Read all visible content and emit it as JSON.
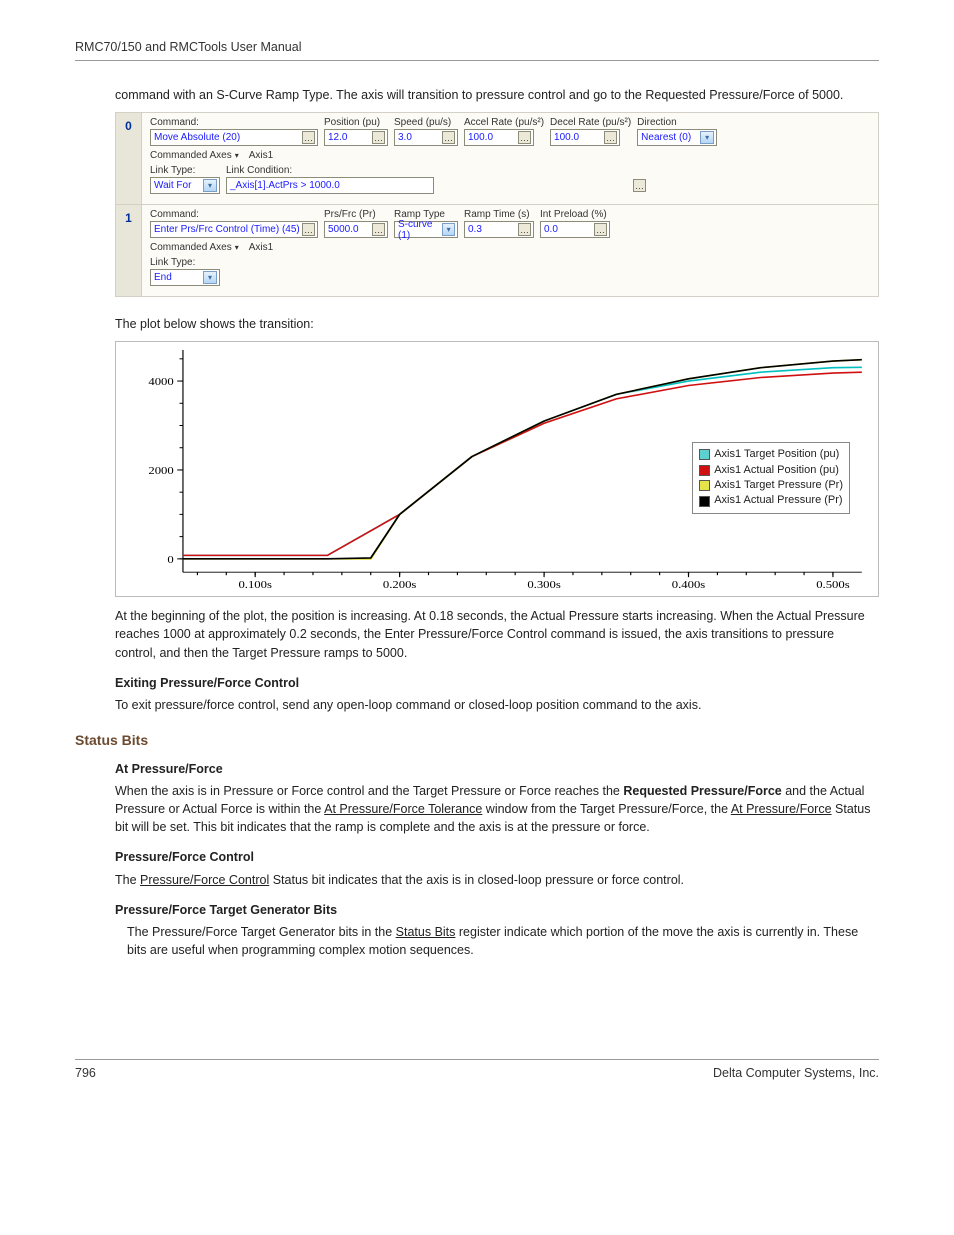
{
  "header": {
    "title": "RMC70/150 and RMCTools User Manual"
  },
  "footer": {
    "page": "796",
    "company": "Delta Computer Systems, Inc."
  },
  "intro": "command with an S-Curve Ramp Type. The axis will transition to pressure control and go to the Requested Pressure/Force of 5000.",
  "steps": [
    {
      "num": "0",
      "fields": [
        {
          "label": "Command:",
          "value": "Move Absolute (20)",
          "w": "wide",
          "edit": "ell"
        },
        {
          "label": "Position (pu)",
          "value": "12.0",
          "w": "w58",
          "edit": "ell"
        },
        {
          "label": "Speed (pu/s)",
          "value": "3.0",
          "w": "w58",
          "edit": "ell"
        },
        {
          "label": "Accel Rate (pu/s²)",
          "value": "100.0",
          "w": "w54",
          "edit": "ell"
        },
        {
          "label": "Decel Rate (pu/s²)",
          "value": "100.0",
          "w": "w54",
          "edit": "ell"
        },
        {
          "label": "Direction",
          "value": "Nearest (0)",
          "w": "dir",
          "edit": "dd"
        }
      ],
      "axes_label": "Commanded Axes",
      "axes_value": "Axis1",
      "link": {
        "type_label": "Link Type:",
        "type_value": "Wait For",
        "cond_label": "Link Condition:",
        "cond_value": "_Axis[1].ActPrs > 1000.0"
      }
    },
    {
      "num": "1",
      "fields": [
        {
          "label": "Command:",
          "value": "Enter Prs/Frc Control (Time) (45)",
          "w": "wide",
          "edit": "ell"
        },
        {
          "label": "Prs/Frc (Pr)",
          "value": "5000.0",
          "w": "w58",
          "edit": "ell"
        },
        {
          "label": "Ramp Type",
          "value": "S-curve (1)",
          "w": "w58",
          "edit": "dd"
        },
        {
          "label": "Ramp Time (s)",
          "value": "0.3",
          "w": "w54",
          "edit": "ell"
        },
        {
          "label": "Int Preload (%)",
          "value": "0.0",
          "w": "w54",
          "edit": "ell"
        }
      ],
      "axes_label": "Commanded Axes",
      "axes_value": "Axis1",
      "link": {
        "type_label": "Link Type:",
        "type_value": "End"
      }
    }
  ],
  "plot_intro": "The plot below shows the transition:",
  "chart_data": {
    "type": "line",
    "xlabel_ticks": [
      "0.100s",
      "0.200s",
      "0.300s",
      "0.400s",
      "0.500s"
    ],
    "y_ticks": [
      0,
      2000,
      4000
    ],
    "xlim": [
      0.05,
      0.52
    ],
    "ylim": [
      -300,
      4700
    ],
    "series": [
      {
        "name": "Axis1 Target Position (pu)",
        "color": "#00bfbf",
        "swatch": "#5dd0d0",
        "x": [
          0.05,
          0.1,
          0.15,
          0.2,
          0.25,
          0.3,
          0.35,
          0.4,
          0.45,
          0.5,
          0.52
        ],
        "values": [
          78,
          78,
          78,
          1000,
          2300,
          3100,
          3700,
          4000,
          4200,
          4300,
          4310
        ]
      },
      {
        "name": "Axis1 Actual Position (pu)",
        "color": "#d01010",
        "swatch": "#d01010",
        "x": [
          0.05,
          0.1,
          0.15,
          0.2,
          0.25,
          0.3,
          0.35,
          0.4,
          0.45,
          0.5,
          0.52
        ],
        "values": [
          78,
          78,
          78,
          1000,
          2300,
          3050,
          3600,
          3900,
          4080,
          4180,
          4200
        ]
      },
      {
        "name": "Axis1 Target Pressure (Pr)",
        "color": "#d0d000",
        "swatch": "#e4e44a",
        "x": [
          0.05,
          0.1,
          0.15,
          0.18,
          0.2,
          0.25,
          0.3,
          0.35,
          0.4,
          0.45,
          0.5,
          0.52
        ],
        "values": [
          0,
          0,
          0,
          0,
          1000,
          2300,
          3100,
          3700,
          4050,
          4300,
          4450,
          4480
        ]
      },
      {
        "name": "Axis1 Actual Pressure (Pr)",
        "color": "#000000",
        "swatch": "#000000",
        "x": [
          0.05,
          0.1,
          0.15,
          0.18,
          0.2,
          0.25,
          0.3,
          0.35,
          0.4,
          0.45,
          0.5,
          0.52
        ],
        "values": [
          0,
          0,
          0,
          20,
          1000,
          2300,
          3100,
          3700,
          4050,
          4300,
          4450,
          4480
        ]
      }
    ]
  },
  "plot_desc": "At the beginning of the plot, the position is increasing. At 0.18 seconds, the Actual Pressure starts increasing. When the Actual Pressure reaches 1000 at approximately 0.2 seconds, the Enter Pressure/Force Control command is issued, the axis transitions to pressure control, and then the Target Pressure ramps to 5000.",
  "exit_h": "Exiting Pressure/Force Control",
  "exit_p": "To exit pressure/force control, send any open-loop command or closed-loop position command to the axis.",
  "status_h": "Status Bits",
  "at_h": "At Pressure/Force",
  "at_p1a": "When the axis is in Pressure or Force control and the Target Pressure or Force reaches the ",
  "at_p1b": "Requested Pressure/Force",
  "at_p1c": " and the Actual Pressure or Actual Force is within the ",
  "at_p1d": "At Pressure/Force Tolerance",
  "at_p1e": " window from the Target Pressure/Force, the ",
  "at_p1f": "At Pressure/Force",
  "at_p1g": " Status bit will be set. This bit indicates that the ramp is complete and the axis is at the pressure or force.",
  "pfc_h": "Pressure/Force Control",
  "pfc_a": "The ",
  "pfc_b": "Pressure/Force Control",
  "pfc_c": " Status bit indicates that the axis is in closed-loop pressure or force control.",
  "tg_h": "Pressure/Force Target Generator Bits",
  "tg_a": "The Pressure/Force Target Generator bits in the ",
  "tg_b": "Status Bits",
  "tg_c": " register indicate which portion of the move the axis is currently in. These bits are useful when programming complex motion sequences."
}
